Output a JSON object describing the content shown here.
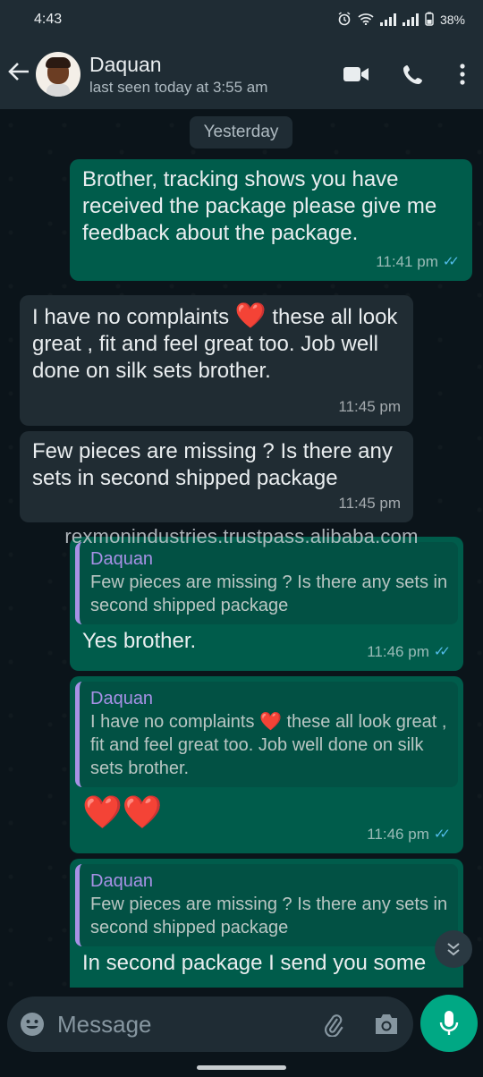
{
  "status_bar": {
    "time": "4:43",
    "battery": "38%"
  },
  "header": {
    "contact_name": "Daquan",
    "last_seen": "last seen today at 3:55 am"
  },
  "chat": {
    "date_chip": "Yesterday",
    "messages": [
      {
        "dir": "out",
        "text": "Brother, tracking shows you have received the package please give me feedback about the package.",
        "time": "11:41 pm",
        "ticks": "✓✓"
      },
      {
        "dir": "in",
        "text_before": "I have no complaints",
        "emoji": "❤️",
        "text_after": "these all look great , fit and feel great too. Job well done on silk sets brother.",
        "time": "11:45 pm"
      },
      {
        "dir": "in",
        "text": "Few pieces are missing ? Is there  any sets in second shipped package",
        "time": "11:45 pm"
      },
      {
        "dir": "out",
        "quote_name": "Daquan",
        "quote_text": "Few pieces are missing ? Is there  any sets in second shipped package",
        "text": "Yes brother.",
        "time": "11:46 pm",
        "ticks": "✓✓"
      },
      {
        "dir": "out",
        "quote_name": "Daquan",
        "quote_text_before": "I have no complaints",
        "quote_emoji": "❤️",
        "quote_text_after": "these all look great , fit and feel great too. Job well done on silk sets brother.",
        "text": "❤️❤️",
        "time": "11:46 pm",
        "ticks": "✓✓"
      },
      {
        "dir": "out",
        "quote_name": "Daquan",
        "quote_text": "Few pieces are missing ? Is there  any sets in second shipped package",
        "text": "In second package I send you some"
      }
    ]
  },
  "watermark": "rexmonindustries.trustpass.alibaba.com",
  "composer": {
    "placeholder": "Message"
  },
  "colors": {
    "accent": "#00a884",
    "outgoing_bubble": "#005c4b",
    "incoming_bubble": "#202c33",
    "read_ticks": "#53bdeb",
    "quote_name": "#a791e6"
  }
}
